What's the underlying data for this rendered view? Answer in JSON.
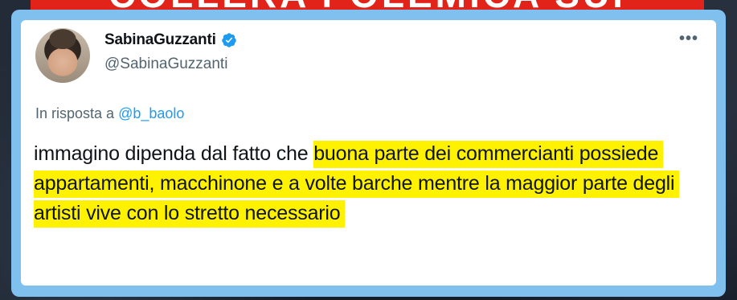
{
  "banner": {
    "text": "COLLERA POLEMICA SUI"
  },
  "tweet": {
    "display_name": "SabinaGuzzanti",
    "handle": "@SabinaGuzzanti",
    "verified": true,
    "reply_prefix": "In risposta a",
    "reply_to": "@b_baolo",
    "text_plain": "immagino dipenda dal fatto che",
    "text_highlighted": "buona parte dei commercianti possiede appartamenti, macchinone e a volte barche mentre la maggior parte degli artisti vive con lo stretto necessario",
    "more_icon": "more-dots-icon"
  },
  "colors": {
    "frame": "#7fc0ee",
    "banner": "#e2231a",
    "highlight": "#fff200",
    "verified": "#1d9bf0",
    "link": "#1d9bf0"
  }
}
